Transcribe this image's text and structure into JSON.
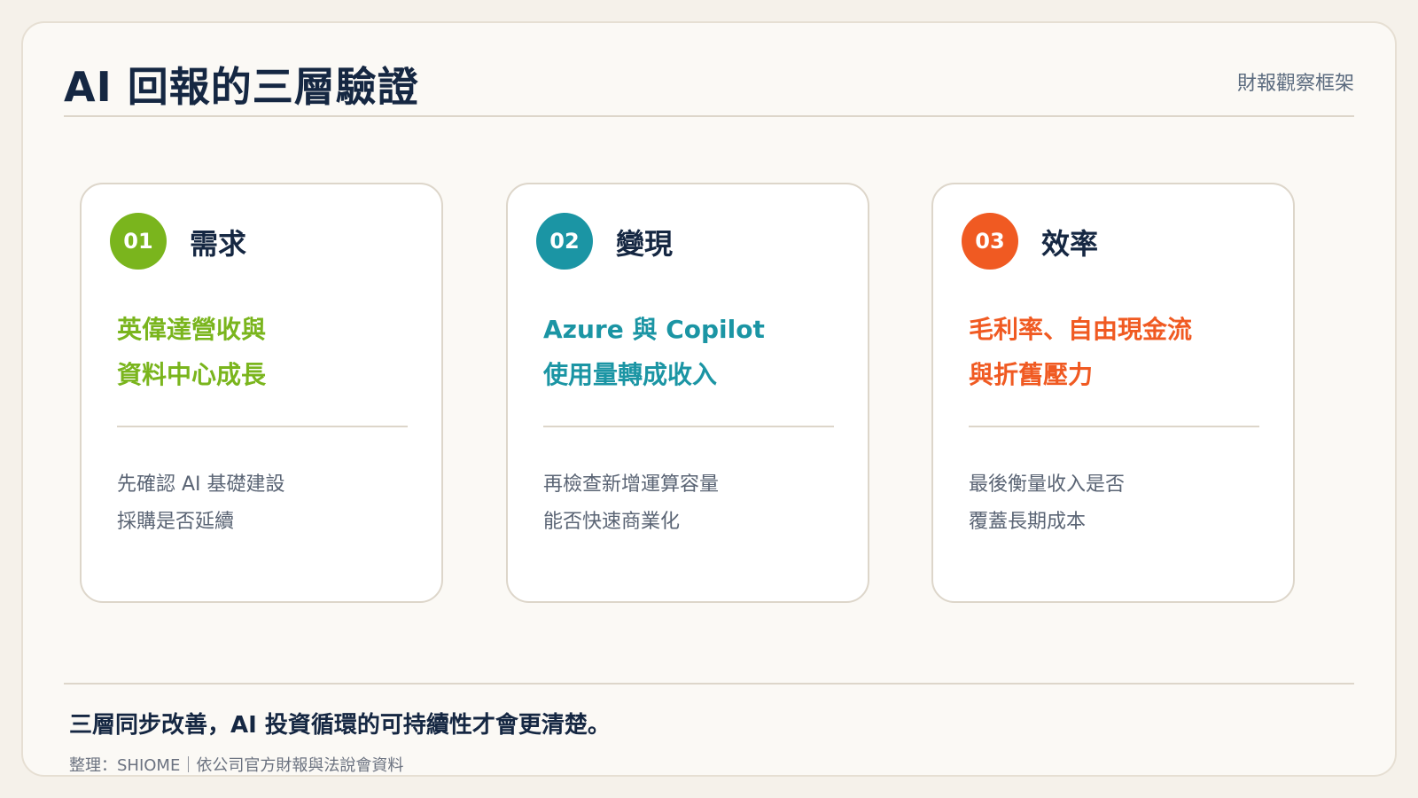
{
  "header": {
    "title": "AI 回報的三層驗證",
    "subtitle": "財報觀察框架"
  },
  "cards": [
    {
      "number": "01",
      "heading": "需求",
      "highlight": [
        "英偉達營收與",
        "資料中心成長"
      ],
      "description": [
        "先確認 AI 基礎建設",
        "採購是否延續"
      ],
      "accent_color": "#7ab51d"
    },
    {
      "number": "02",
      "heading": "變現",
      "highlight": [
        "Azure 與 Copilot",
        "使用量轉成收入"
      ],
      "description": [
        "再檢查新增運算容量",
        "能否快速商業化"
      ],
      "accent_color": "#1b95a4"
    },
    {
      "number": "03",
      "heading": "效率",
      "highlight": [
        "毛利率、自由現金流",
        "與折舊壓力"
      ],
      "description": [
        "最後衡量收入是否",
        "覆蓋長期成本"
      ],
      "accent_color": "#f05a22"
    }
  ],
  "footer": {
    "conclusion": "三層同步改善，AI 投資循環的可持續性才會更清楚。",
    "source": "整理：SHIOME｜依公司官方財報與法說會資料"
  },
  "colors": {
    "background": "#f5f1ea",
    "panel": "#fbf9f5",
    "title": "#152742",
    "border": "#ddd6ca"
  }
}
